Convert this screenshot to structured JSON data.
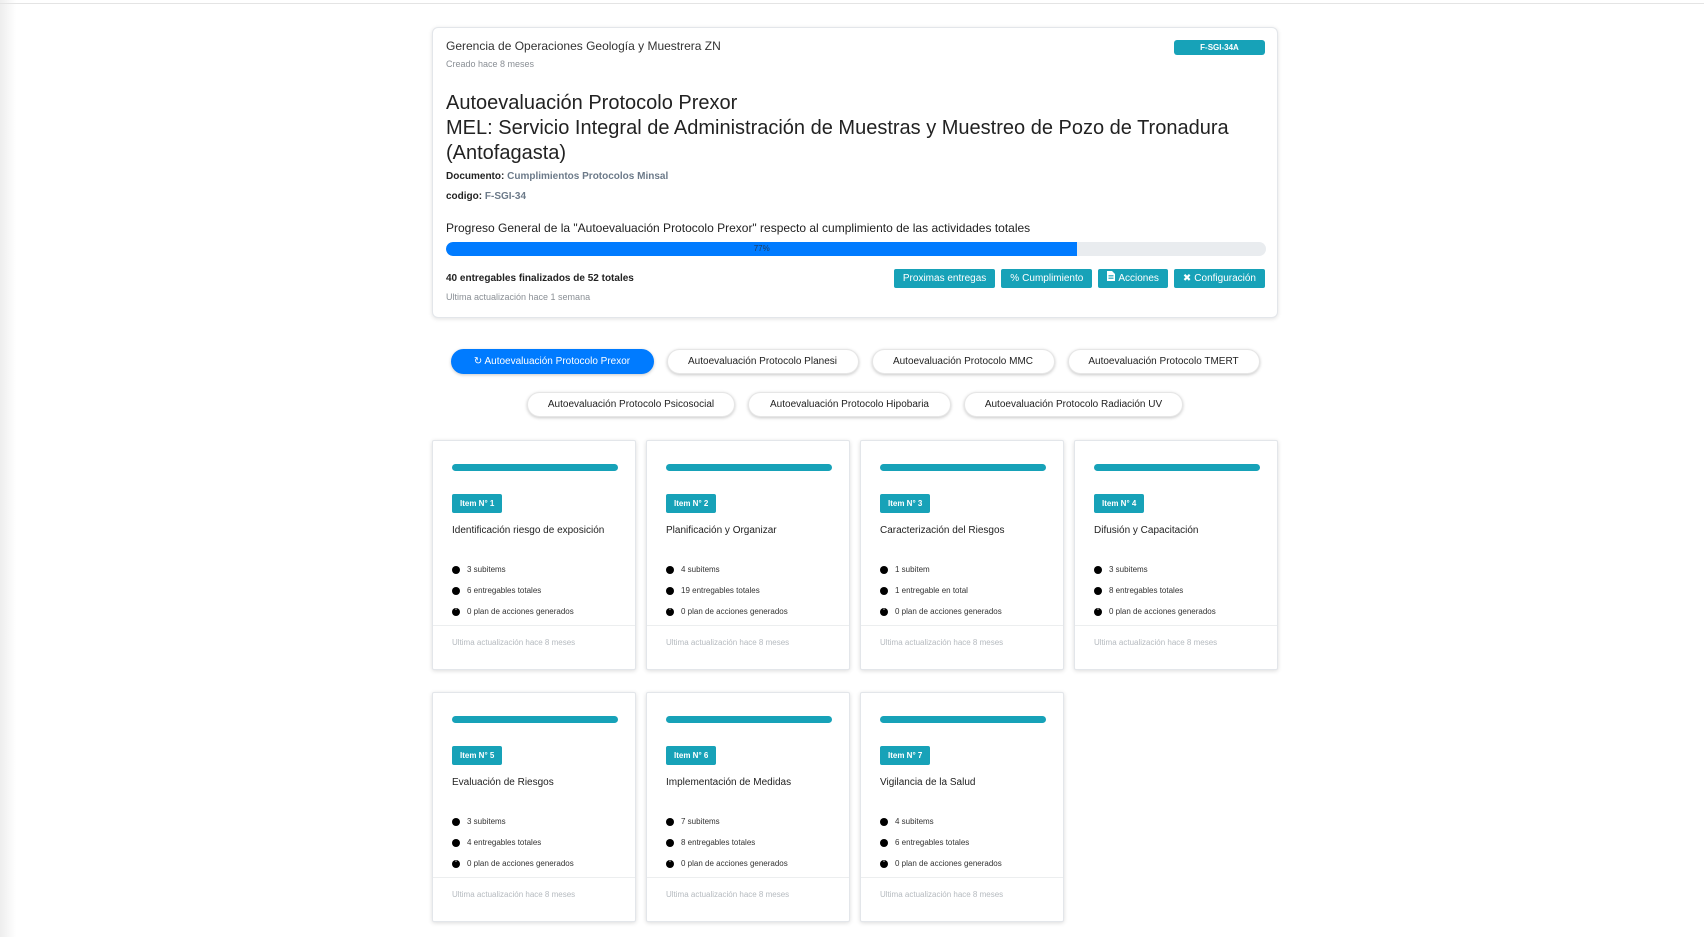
{
  "header": {
    "area": "Gerencia de Operaciones Geología y Muestrera ZN",
    "created": "Creado hace 8 meses",
    "code_badge": "F-SGI-34A",
    "title_line1": "Autoevaluación Protocolo Prexor",
    "title_line2": "MEL: Servicio Integral de Administración de Muestras y Muestreo de Pozo de Tronadura (Antofagasta)",
    "documento_label": "Documento:",
    "documento_value": "Cumplimientos Protocolos Minsal",
    "codigo_label": "codigo:",
    "codigo_value": "F-SGI-34",
    "progress_text": "Progreso General de la \"Autoevaluación Protocolo Prexor\" respecto al cumplimiento de las actividades totales",
    "progress_percent": 77,
    "progress_label": "77%",
    "deliverables": "40 entregables finalizados de 52 totales",
    "updated": "Ultima actualización hace 1 semana"
  },
  "actions": [
    {
      "label": "Proximas entregas",
      "icon": ""
    },
    {
      "label": "Cumplimiento",
      "icon": "percent-icon"
    },
    {
      "label": "Acciones",
      "icon": "file-icon"
    },
    {
      "label": "Configuración",
      "icon": "tools-icon"
    }
  ],
  "protocols_row1": [
    {
      "label": "Autoevaluación Protocolo Prexor",
      "active": true
    },
    {
      "label": "Autoevaluación Protocolo Planesi",
      "active": false
    },
    {
      "label": "Autoevaluación Protocolo MMC",
      "active": false
    },
    {
      "label": "Autoevaluación Protocolo TMERT",
      "active": false
    }
  ],
  "protocols_row2": [
    {
      "label": "Autoevaluación Protocolo Psicosocial",
      "active": false
    },
    {
      "label": "Autoevaluación Protocolo Hipobaria",
      "active": false
    },
    {
      "label": "Autoevaluación Protocolo Radiación UV",
      "active": false
    }
  ],
  "items": [
    {
      "tag": "Item N° 1",
      "name": "Identificación riesgo de exposición",
      "sub": "3 subitems",
      "deliv": "6 entregables totales",
      "plans": "0 plan de acciones generados",
      "updated": "Ultima actualización hace 8 meses"
    },
    {
      "tag": "Item N° 2",
      "name": "Planificación y Organizar",
      "sub": "4 subitems",
      "deliv": "19 entregables totales",
      "plans": "0 plan de acciones generados",
      "updated": "Ultima actualización hace 8 meses"
    },
    {
      "tag": "Item N° 3",
      "name": "Caracterización del Riesgos",
      "sub": "1 subitem",
      "deliv": "1 entregable en total",
      "plans": "0 plan de acciones generados",
      "updated": "Ultima actualización hace 8 meses"
    },
    {
      "tag": "Item N° 4",
      "name": "Difusión y Capacitación",
      "sub": "3 subitems",
      "deliv": "8 entregables totales",
      "plans": "0 plan de acciones generados",
      "updated": "Ultima actualización hace 8 meses"
    },
    {
      "tag": "Item N° 5",
      "name": "Evaluación de Riesgos",
      "sub": "3 subitems",
      "deliv": "4 entregables totales",
      "plans": "0 plan de acciones generados",
      "updated": "Ultima actualización hace 8 meses"
    },
    {
      "tag": "Item N° 6",
      "name": "Implementación de Medidas",
      "sub": "7 subitems",
      "deliv": "8 entregables totales",
      "plans": "0 plan de acciones generados",
      "updated": "Ultima actualización hace 8 meses"
    },
    {
      "tag": "Item N° 7",
      "name": "Vigilancia de la Salud",
      "sub": "4 subitems",
      "deliv": "6 entregables totales",
      "plans": "0 plan de acciones generados",
      "updated": "Ultima actualización hace 8 meses"
    }
  ],
  "colors": {
    "accent": "#17a2b8",
    "primary": "#007bff"
  }
}
